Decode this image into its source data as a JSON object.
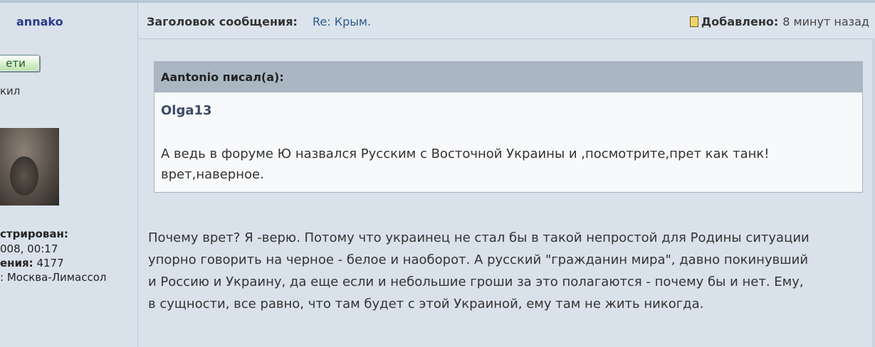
{
  "author": {
    "username": "annako",
    "friend_button": "ети",
    "role": "кил",
    "registered_label": "стрирован:",
    "registered_value": "008, 00:17",
    "posts_label": "ения:",
    "posts_value": "4177",
    "location_value": ": Москва-Лимассол"
  },
  "header": {
    "subject_label": "Заголовок сообщения:",
    "subject_value": "Re: Крым.",
    "added_label": "Добавлено:",
    "added_value": "8 минут назад"
  },
  "quote": {
    "header": "Aantonio писал(а):",
    "author": "Olga13",
    "text_line1": "А ведь в форуме Ю назвался Русским с Восточной Украины и ,посмотрите,прет как танк!",
    "text_line2": "врет,наверное."
  },
  "post": {
    "line1": "Почему врет? Я -верю. Потому что украинец не стал бы в такой непростой для Родины ситуации",
    "line2": "упорно говорить на черное - белое и наоборот. А русский \"гражданин мира\", давно покинувший",
    "line3": "и Россию и Украину, да еще если и небольшие гроши за это полагаются - почему бы и нет. Ему,",
    "line4": "в сущности, все равно, что там будет с этой Украиной, ему там не жить никогда."
  }
}
